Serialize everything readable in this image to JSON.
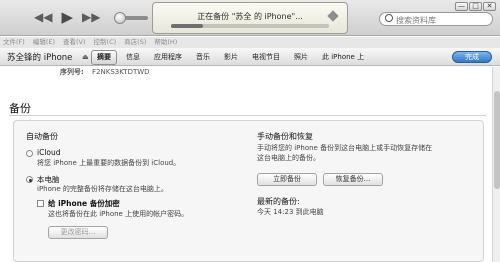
{
  "window": {
    "minimize": "—",
    "maximize": "□",
    "close": "✕"
  },
  "lcd": {
    "now_playing": "正在备份 \"苏全      的 iPhone\"...",
    "progress": 0.2
  },
  "search": {
    "placeholder": "搜索资料库"
  },
  "menu": [
    "文件(F)",
    "编辑(E)",
    "查看(V)",
    "控制(C)",
    "商店(S)",
    "帮助(H)"
  ],
  "device": {
    "name": "苏全锋的 iPhone"
  },
  "tabs": [
    "摘要",
    "信息",
    "应用程序",
    "音乐",
    "影片",
    "电视节目",
    "照片",
    "此 iPhone 上"
  ],
  "done_label": "完成",
  "serial": {
    "label": "序列号:",
    "value": "F2NKS3KTDTWD"
  },
  "backup": {
    "section_title": "备份",
    "auto": {
      "heading": "自动备份",
      "icloud_label": "iCloud",
      "icloud_desc": "将您 iPhone 上最重要的数据备份到 iCloud。",
      "local_label": "本电脑",
      "local_desc": "iPhone 的完整备份将存储在这台电脑上。",
      "encrypt_label": "给 iPhone 备份加密",
      "encrypt_desc": "这也将备份在此 iPhone 上使用的帐户密码。",
      "change_password": "更改密码..."
    },
    "manual": {
      "heading": "手动备份和恢复",
      "desc_line1": "手动将您的 iPhone 备份到这台电脑上或手动恢复存储在",
      "desc_line2": "这台电脑上的备份。",
      "backup_now": "立即备份",
      "restore": "恢复备份...",
      "latest_heading": "最新的备份:",
      "latest_value": "今天 14:23 到此电脑"
    }
  },
  "icons": {
    "prev": "rewind-icon",
    "play": "play-icon",
    "next": "fast-forward-icon",
    "volume": "volume-slider",
    "search": "search-icon",
    "eject": "eject-icon"
  }
}
